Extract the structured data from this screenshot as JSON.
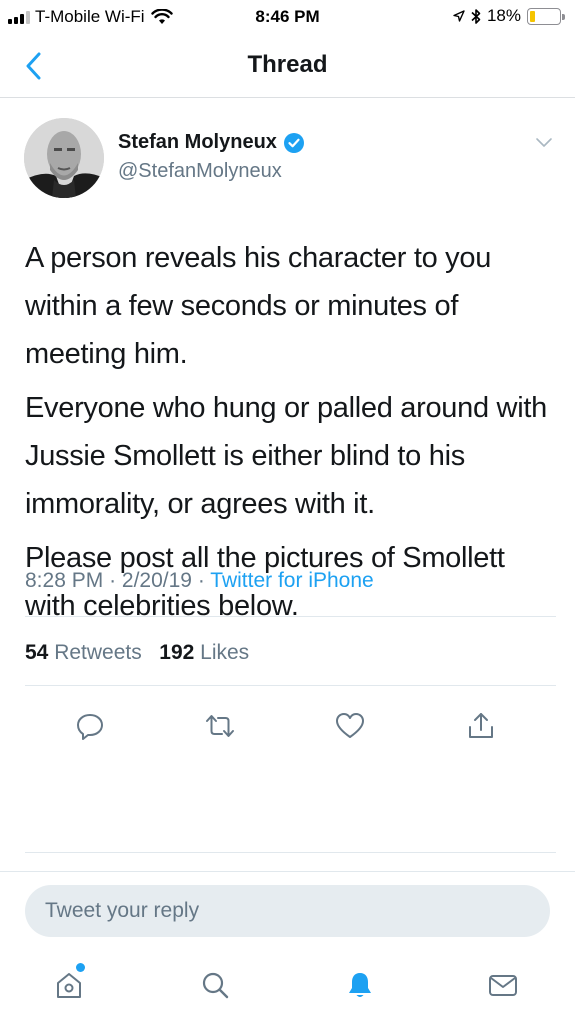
{
  "status_bar": {
    "carrier": "T-Mobile Wi-Fi",
    "time": "8:46 PM",
    "battery_percent": "18%",
    "battery_level": 0.18,
    "battery_color": "#f5c400",
    "icons": [
      "signal-icon",
      "wifi-icon",
      "location-icon",
      "bluetooth-icon",
      "battery-icon"
    ]
  },
  "nav": {
    "title": "Thread",
    "back_icon": "chevron-left-icon",
    "accent_color": "#1da1f2"
  },
  "tweet": {
    "author_name": "Stefan Molyneux",
    "author_handle": "@StefanMolyneux",
    "verified": true,
    "paragraphs": [
      "A person reveals his character to you within a few seconds or minutes of meeting him.",
      "Everyone who hung or palled around with Jussie Smollett is either blind to his immorality, or agrees with it.",
      "Please post all the pictures of Smollett with celebrities below."
    ],
    "time": "8:28 PM",
    "date": "2/20/19",
    "separator": "·",
    "source": "Twitter for iPhone",
    "retweets_count": "54",
    "retweets_label": "Retweets",
    "likes_count": "192",
    "likes_label": "Likes"
  },
  "actions": [
    {
      "name": "reply-icon"
    },
    {
      "name": "retweet-icon"
    },
    {
      "name": "like-icon"
    },
    {
      "name": "share-icon"
    }
  ],
  "reply_box": {
    "placeholder": "Tweet your reply"
  },
  "tab_bar": {
    "tabs": [
      "home-icon",
      "search-icon",
      "notifications-icon",
      "messages-icon"
    ],
    "active": "notifications-icon",
    "has_new_home_dot": true
  }
}
